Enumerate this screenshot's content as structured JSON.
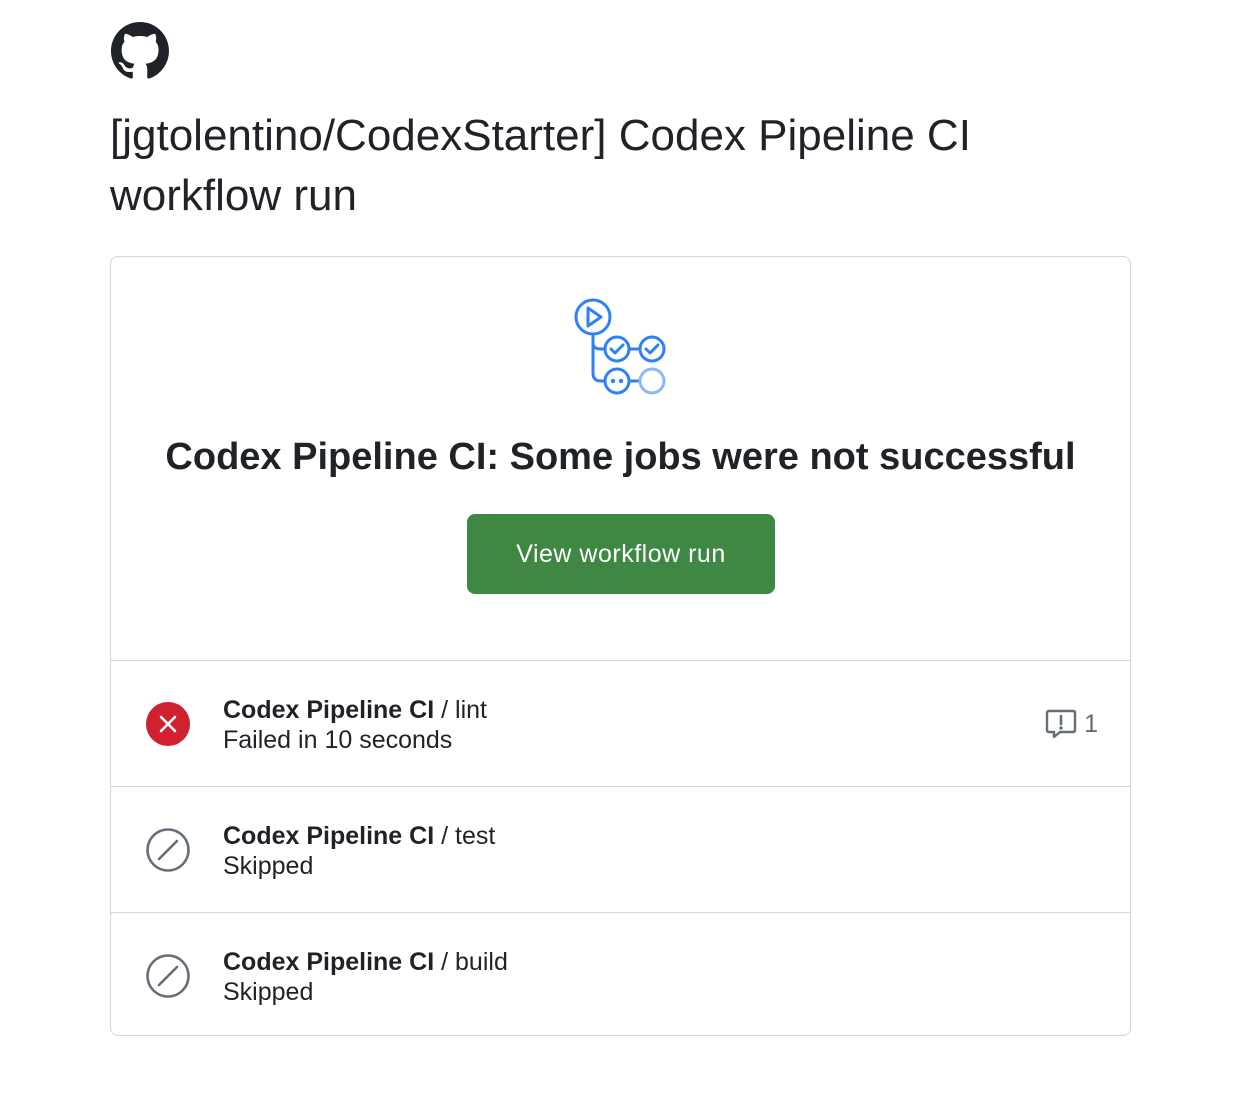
{
  "email": {
    "logo_icon": "github-mark-icon",
    "title": "[jgtolentino/CodexStarter] Codex Pipeline CI workflow run"
  },
  "run": {
    "icon": "workflow-run-icon",
    "headline": "Codex Pipeline CI: Some jobs were not successful",
    "view_button_label": "View workflow run",
    "button_color": "#3f8843"
  },
  "jobs": [
    {
      "workflow": "Codex Pipeline CI",
      "separator": "/",
      "name": "lint",
      "detail": "Failed in 10 seconds",
      "status": "failed",
      "status_icon": "x-circle-fill-icon",
      "annotation_icon": "comment-alert-icon",
      "annotation_count": "1"
    },
    {
      "workflow": "Codex Pipeline CI",
      "separator": "/",
      "name": "test",
      "detail": "Skipped",
      "status": "skipped",
      "status_icon": "skip-icon"
    },
    {
      "workflow": "Codex Pipeline CI",
      "separator": "/",
      "name": "build",
      "detail": "Skipped",
      "status": "skipped",
      "status_icon": "skip-icon"
    }
  ],
  "colors": {
    "failed": "#cf222e",
    "skipped": "#656d76",
    "accent_blue": "#2f81f7"
  }
}
